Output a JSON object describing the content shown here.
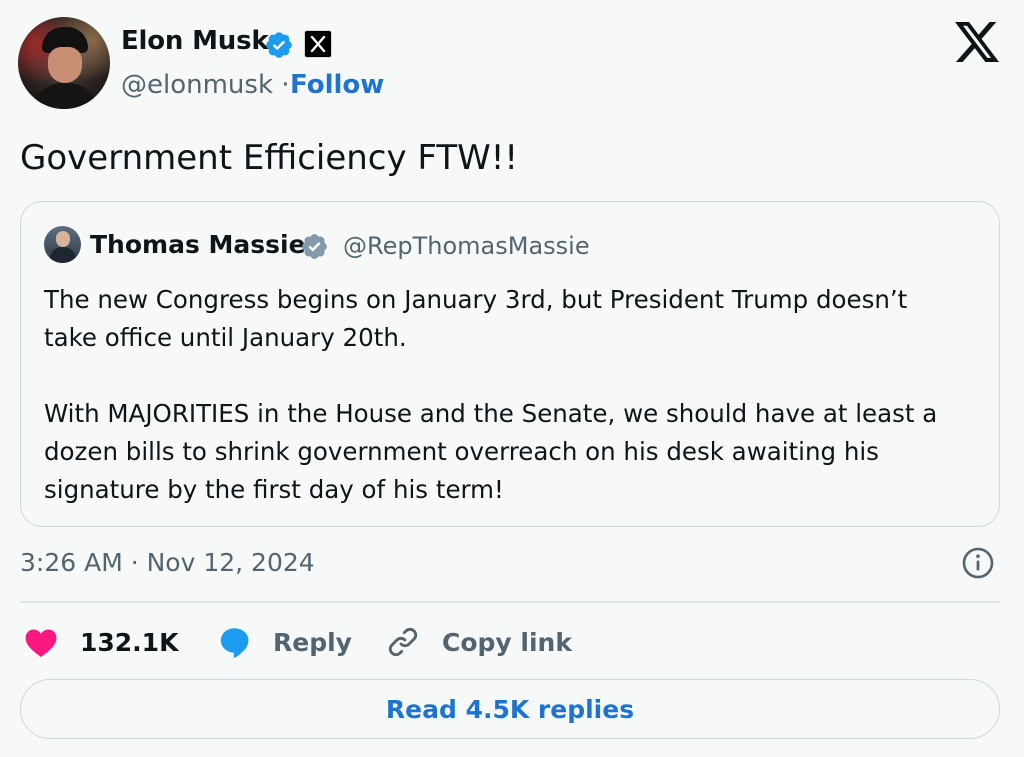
{
  "author": {
    "name": "Elon Musk",
    "handle": "@elonmusk",
    "separator": "·",
    "follow_label": "Follow",
    "verified_color": "#1d9bf0"
  },
  "tweet": {
    "text": "Government Efficiency FTW!!",
    "timestamp": "3:26 AM · Nov 12, 2024"
  },
  "quoted_tweet": {
    "name": "Thomas Massie",
    "handle": "@RepThomasMassie",
    "verified_color": "#829aab",
    "paragraphs": [
      "The new Congress begins on January 3rd, but President Trump doesn’t\ntake office until January 20th.",
      "With MAJORITIES in the House and the Senate, we should have at least a\ndozen bills to shrink government overreach on his desk awaiting his\nsignature by the first day of his term!"
    ]
  },
  "actions": {
    "like_count": "132.1K",
    "reply_label": "Reply",
    "copy_link_label": "Copy link",
    "like_color": "#f91880",
    "reply_color": "#1d9bf0"
  },
  "read_replies_label": "Read 4.5K replies",
  "icons": [
    "verified-badge-icon",
    "x-affiliate-badge-icon",
    "x-logo-icon",
    "info-icon",
    "heart-icon",
    "reply-bubble-icon",
    "link-icon"
  ]
}
